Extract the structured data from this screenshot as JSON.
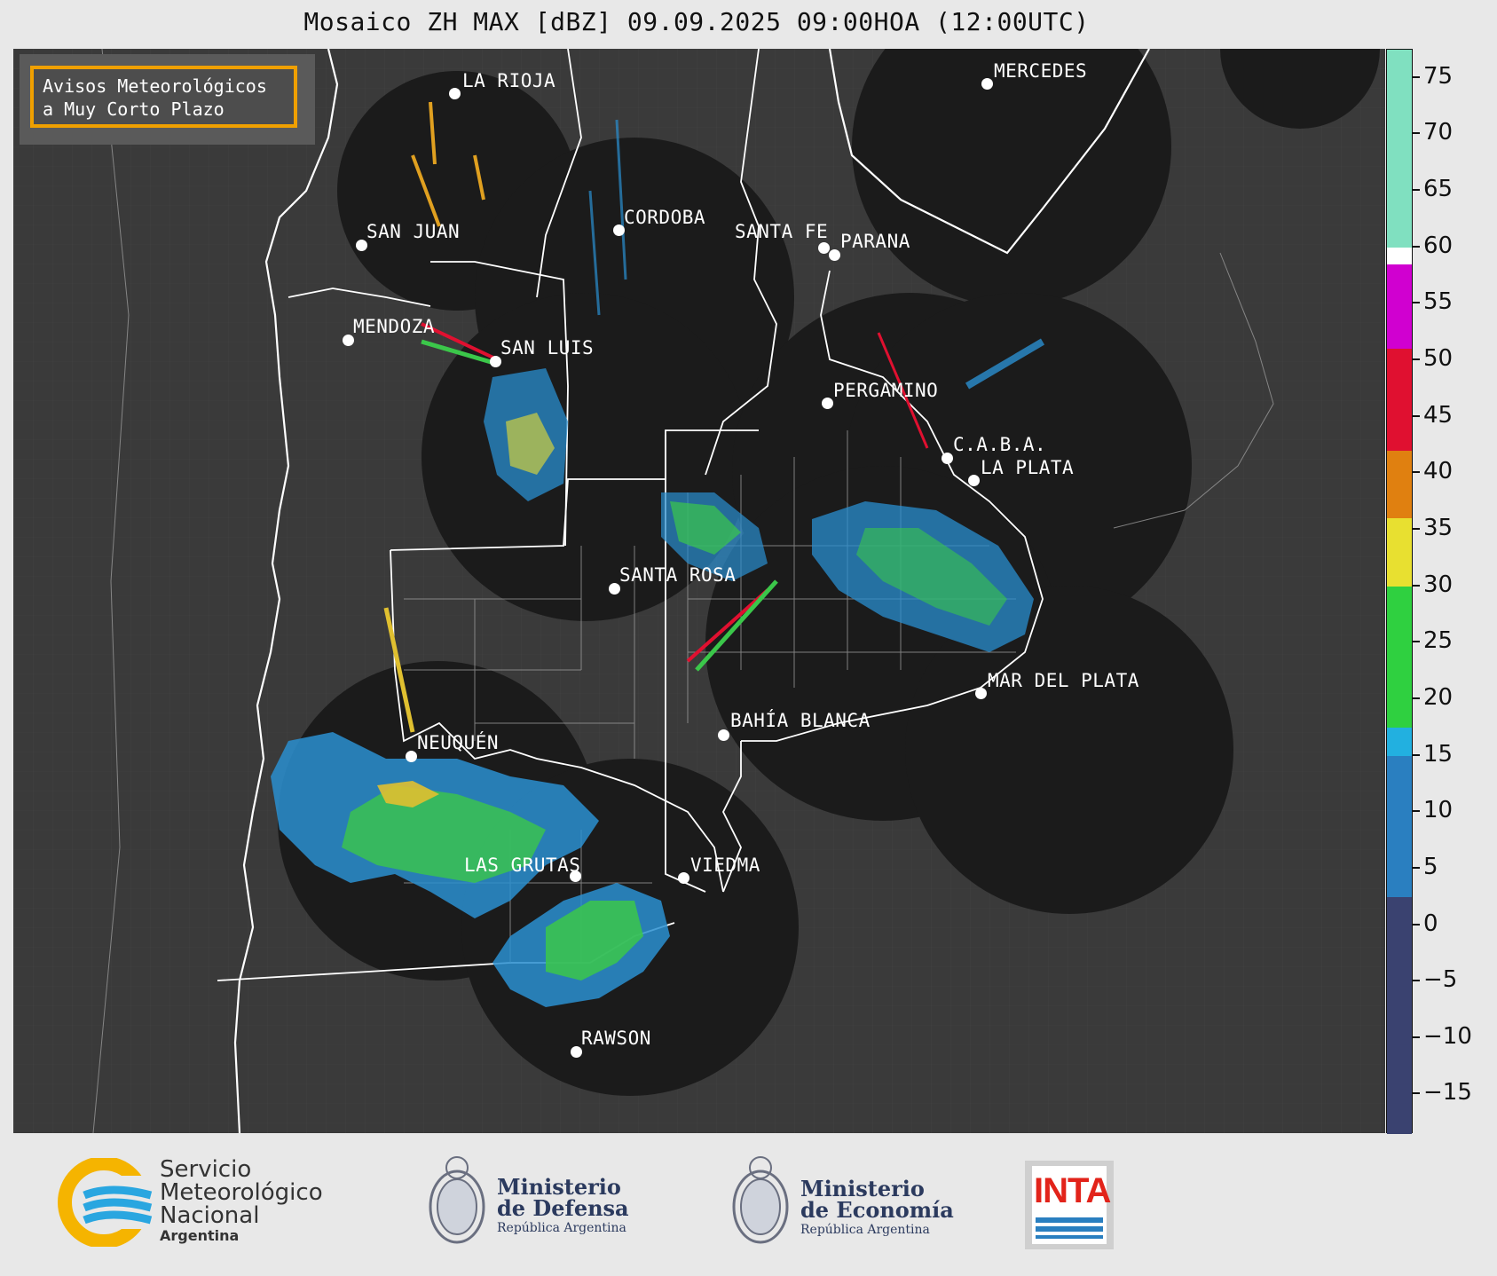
{
  "title": "Mosaico ZH MAX [dBZ] 09.09.2025 09:00HOA (12:00UTC)",
  "badge": {
    "line1": "Avisos Meteorológicos",
    "line2": "a Muy Corto Plazo"
  },
  "cities": [
    {
      "key": "la-rioja",
      "name": "LA RIOJA"
    },
    {
      "key": "mercedes",
      "name": "MERCEDES"
    },
    {
      "key": "cordoba",
      "name": "CORDOBA"
    },
    {
      "key": "san-juan",
      "name": "SAN JUAN"
    },
    {
      "key": "santa-fe",
      "name": "SANTA FE"
    },
    {
      "key": "parana",
      "name": "PARANA"
    },
    {
      "key": "mendoza",
      "name": "MENDOZA"
    },
    {
      "key": "san-luis",
      "name": "SAN LUIS"
    },
    {
      "key": "pergamino",
      "name": "PERGAMINO"
    },
    {
      "key": "caba",
      "name": "C.A.B.A."
    },
    {
      "key": "la-plata",
      "name": "LA PLATA"
    },
    {
      "key": "santa-rosa",
      "name": "SANTA ROSA"
    },
    {
      "key": "mar-del-plata",
      "name": "MAR DEL PLATA"
    },
    {
      "key": "bahia-blanca",
      "name": "BAHÍA BLANCA"
    },
    {
      "key": "neuquen",
      "name": "NEUQUÉN"
    },
    {
      "key": "las-grutas",
      "name": "LAS GRUTAS"
    },
    {
      "key": "viedma",
      "name": "VIEDMA"
    },
    {
      "key": "rawson",
      "name": "RAWSON"
    }
  ],
  "colorbar": {
    "labels": [
      "75",
      "70",
      "65",
      "60",
      "55",
      "50",
      "45",
      "40",
      "35",
      "30",
      "25",
      "20",
      "15",
      "10",
      "5",
      "0",
      "−5",
      "−10",
      "−15"
    ],
    "colors": {
      "low": "#3a4270",
      "blue": "#2a7fc0",
      "cyan": "#22b0e0",
      "green": "#2fd040",
      "yellow": "#e8e030",
      "orange": "#e08010",
      "red": "#e01030",
      "magenta": "#d000d0",
      "white": "#ffffff",
      "aqua": "#80e0c0"
    }
  },
  "logos": {
    "smn": {
      "line1": "Servicio",
      "line2": "Meteorológico",
      "line3": "Nacional",
      "line4": "Argentina"
    },
    "defensa": {
      "line1": "Ministerio",
      "line2": "de Defensa",
      "line3": "República Argentina"
    },
    "economia": {
      "line1": "Ministerio",
      "line2": "de Economía",
      "line3": "República Argentina"
    },
    "inta": {
      "text": "INTA"
    }
  }
}
